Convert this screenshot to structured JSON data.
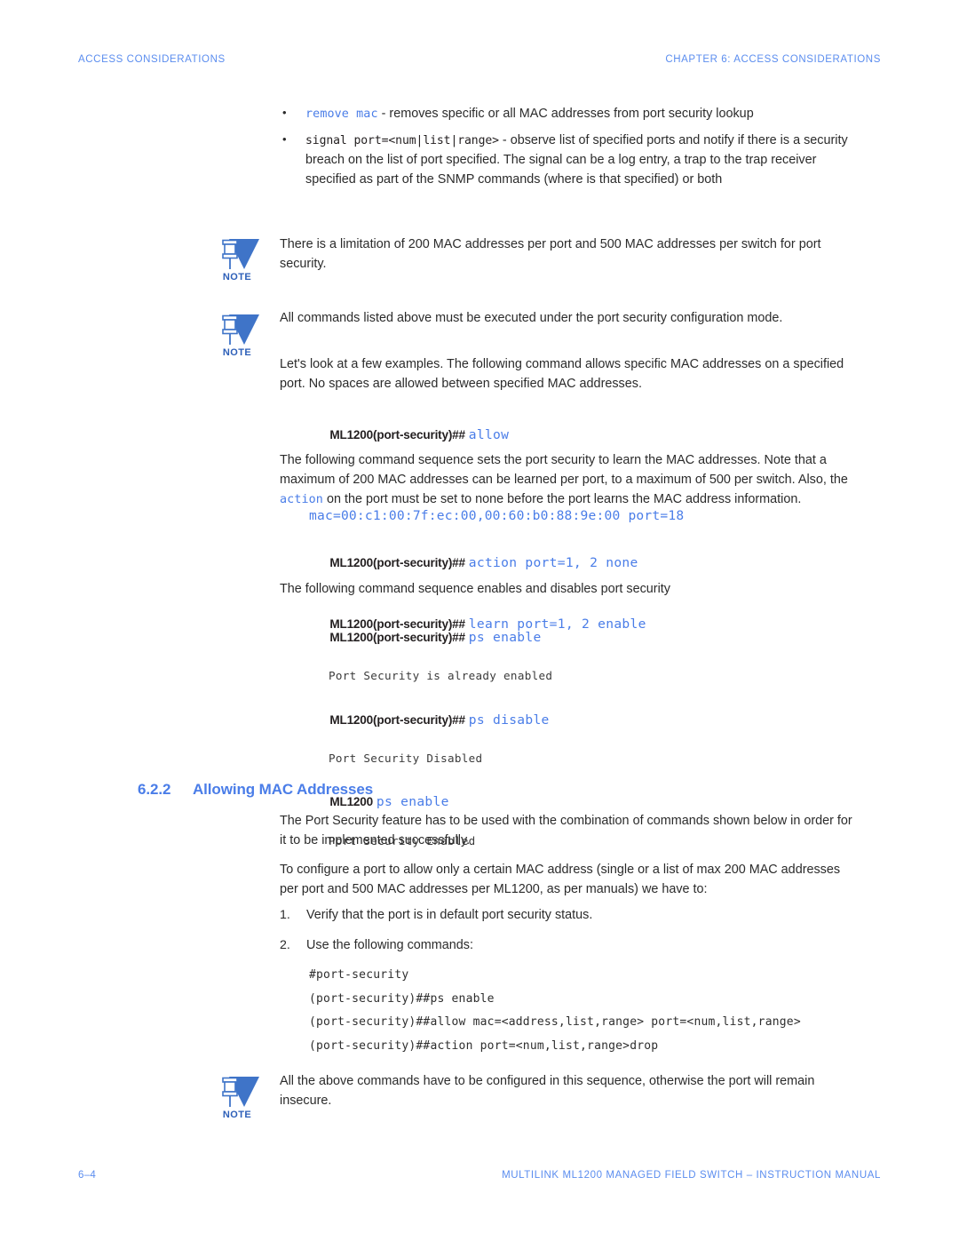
{
  "header": {
    "left": "ACCESS CONSIDERATIONS",
    "right": "CHAPTER 6: ACCESS CONSIDERATIONS"
  },
  "footer": {
    "page_number": "6–4",
    "right": "MULTILINK ML1200 MANAGED FIELD SWITCH – INSTRUCTION MANUAL"
  },
  "colors": {
    "accent_blue": "#4a7de8",
    "header_blue": "#5b8def",
    "body_text": "#2b2b2b",
    "note_blue": "#2d5fb8"
  },
  "bullets": [
    {
      "code": "remove mac",
      "code_style": "blue",
      "text": " - removes specific or all MAC addresses from port security lookup"
    },
    {
      "code": "signal port=<num|list|range>",
      "code_style": "black",
      "text": " - observe list of specified ports and notify if there is a security breach on the list of port specified. The signal can be a log entry, a trap to the trap receiver specified as part of the SNMP commands (where is that specified) or both"
    }
  ],
  "notes": {
    "icon_label": "NOTE",
    "note1": "There is a limitation of 200 MAC addresses per port and 500 MAC addresses per switch for port security.",
    "note2": "All commands listed above must be executed under the port security configuration mode.",
    "note3": "All the above commands have to be configured in this sequence, otherwise the port will remain insecure."
  },
  "paragraphs": {
    "examples_intro": "Let's look at a few examples. The following command allows specific MAC addresses on a specified port. No spaces are allowed between specified MAC addresses.",
    "learn_intro_a": "The following command sequence sets the port security to learn the MAC addresses. Note that a maximum of 200 MAC addresses can be learned per port, to a maximum of 500 per switch. Also, the ",
    "learn_intro_code": "action",
    "learn_intro_b": " on the port must be set to none before the port learns the MAC address information.",
    "ps_intro": "The following command sequence enables and disables port security",
    "feature_intro": "The Port Security feature has to be used with the combination of commands shown below in order for it to be implemented successfully.",
    "configure_intro": "To configure a port to allow only a certain MAC address (single or a list of max 200 MAC addresses per port and 500 MAC addresses per ML1200, as per manuals) we have to:"
  },
  "cli": {
    "allow": {
      "prompt": "ML1200(port-security)##",
      "command": "allow",
      "continuation": "mac=00:c1:00:7f:ec:00,00:60:b0:88:9e:00 port=18"
    },
    "action_learn": [
      {
        "prompt": "ML1200(port-security)##",
        "command": "action port=1, 2 none"
      },
      {
        "prompt": "ML1200(port-security)##",
        "command": "learn port=1, 2 enable"
      }
    ],
    "ps_sequence": [
      {
        "prompt": "ML1200(port-security)##",
        "command": "ps enable",
        "output": "Port Security is already enabled"
      },
      {
        "prompt": "ML1200(port-security)##",
        "command": "ps disable",
        "output": "Port Security Disabled"
      },
      {
        "prompt": "ML1200",
        "command": "ps enable",
        "output": "Port Security Enabled"
      }
    ]
  },
  "section": {
    "number": "6.2.2",
    "title": "Allowing MAC Addresses"
  },
  "steps": [
    {
      "num": "1.",
      "text": "Verify that the port is in default port security status."
    },
    {
      "num": "2.",
      "text": "Use the following commands:"
    }
  ],
  "codeblock": {
    "line1": "#port-security",
    "line2": "(port-security)##ps enable",
    "line3": "(port-security)##allow mac=<address,list,range> port=<num,list,range>",
    "line4": "(port-security)##action port=<num,list,range>drop"
  }
}
